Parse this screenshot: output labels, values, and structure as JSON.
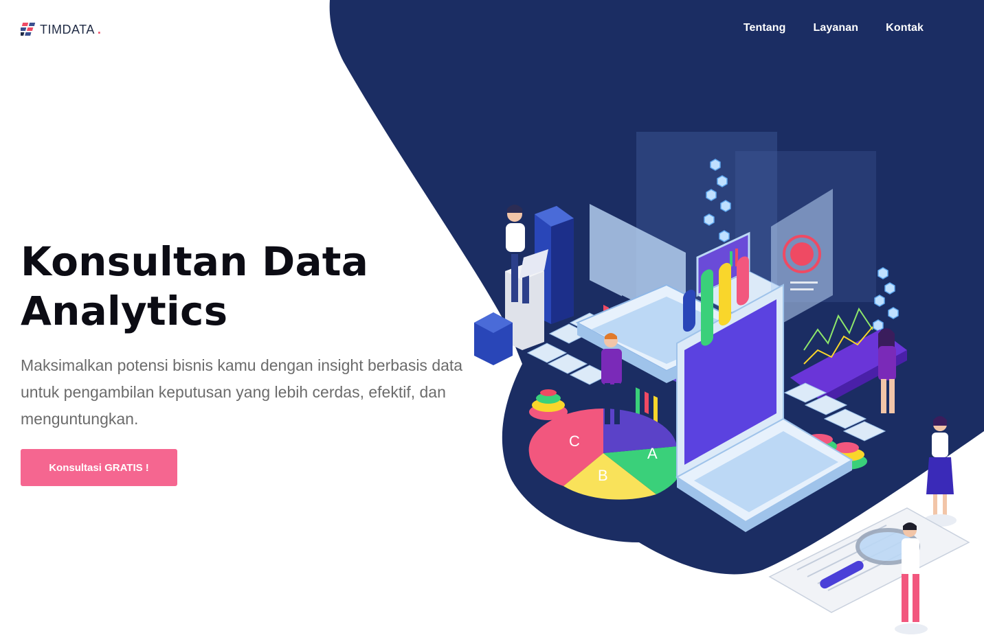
{
  "brand": {
    "name": "TIMDATA",
    "dot": ".",
    "colors": {
      "navy": "#1b2d63",
      "accent_pink": "#f56690",
      "logo_red": "#ef4a63",
      "heading": "#0c0c14",
      "body_text": "#6b6b6b"
    }
  },
  "nav": {
    "items": [
      {
        "label": "Tentang"
      },
      {
        "label": "Layanan"
      },
      {
        "label": "Kontak"
      }
    ]
  },
  "hero": {
    "title_line1": "Konsultan Data",
    "title_line2": "Analytics",
    "description": "Maksimalkan potensi bisnis kamu dengan insight berbasis data untuk pengambilan keputusan yang lebih cerdas, efektif, dan menguntungkan.",
    "cta_label": "Konsultasi GRATIS !"
  },
  "illustration": {
    "pie_labels": [
      "C",
      "A",
      "B"
    ],
    "subject": "isometric-data-analytics"
  }
}
